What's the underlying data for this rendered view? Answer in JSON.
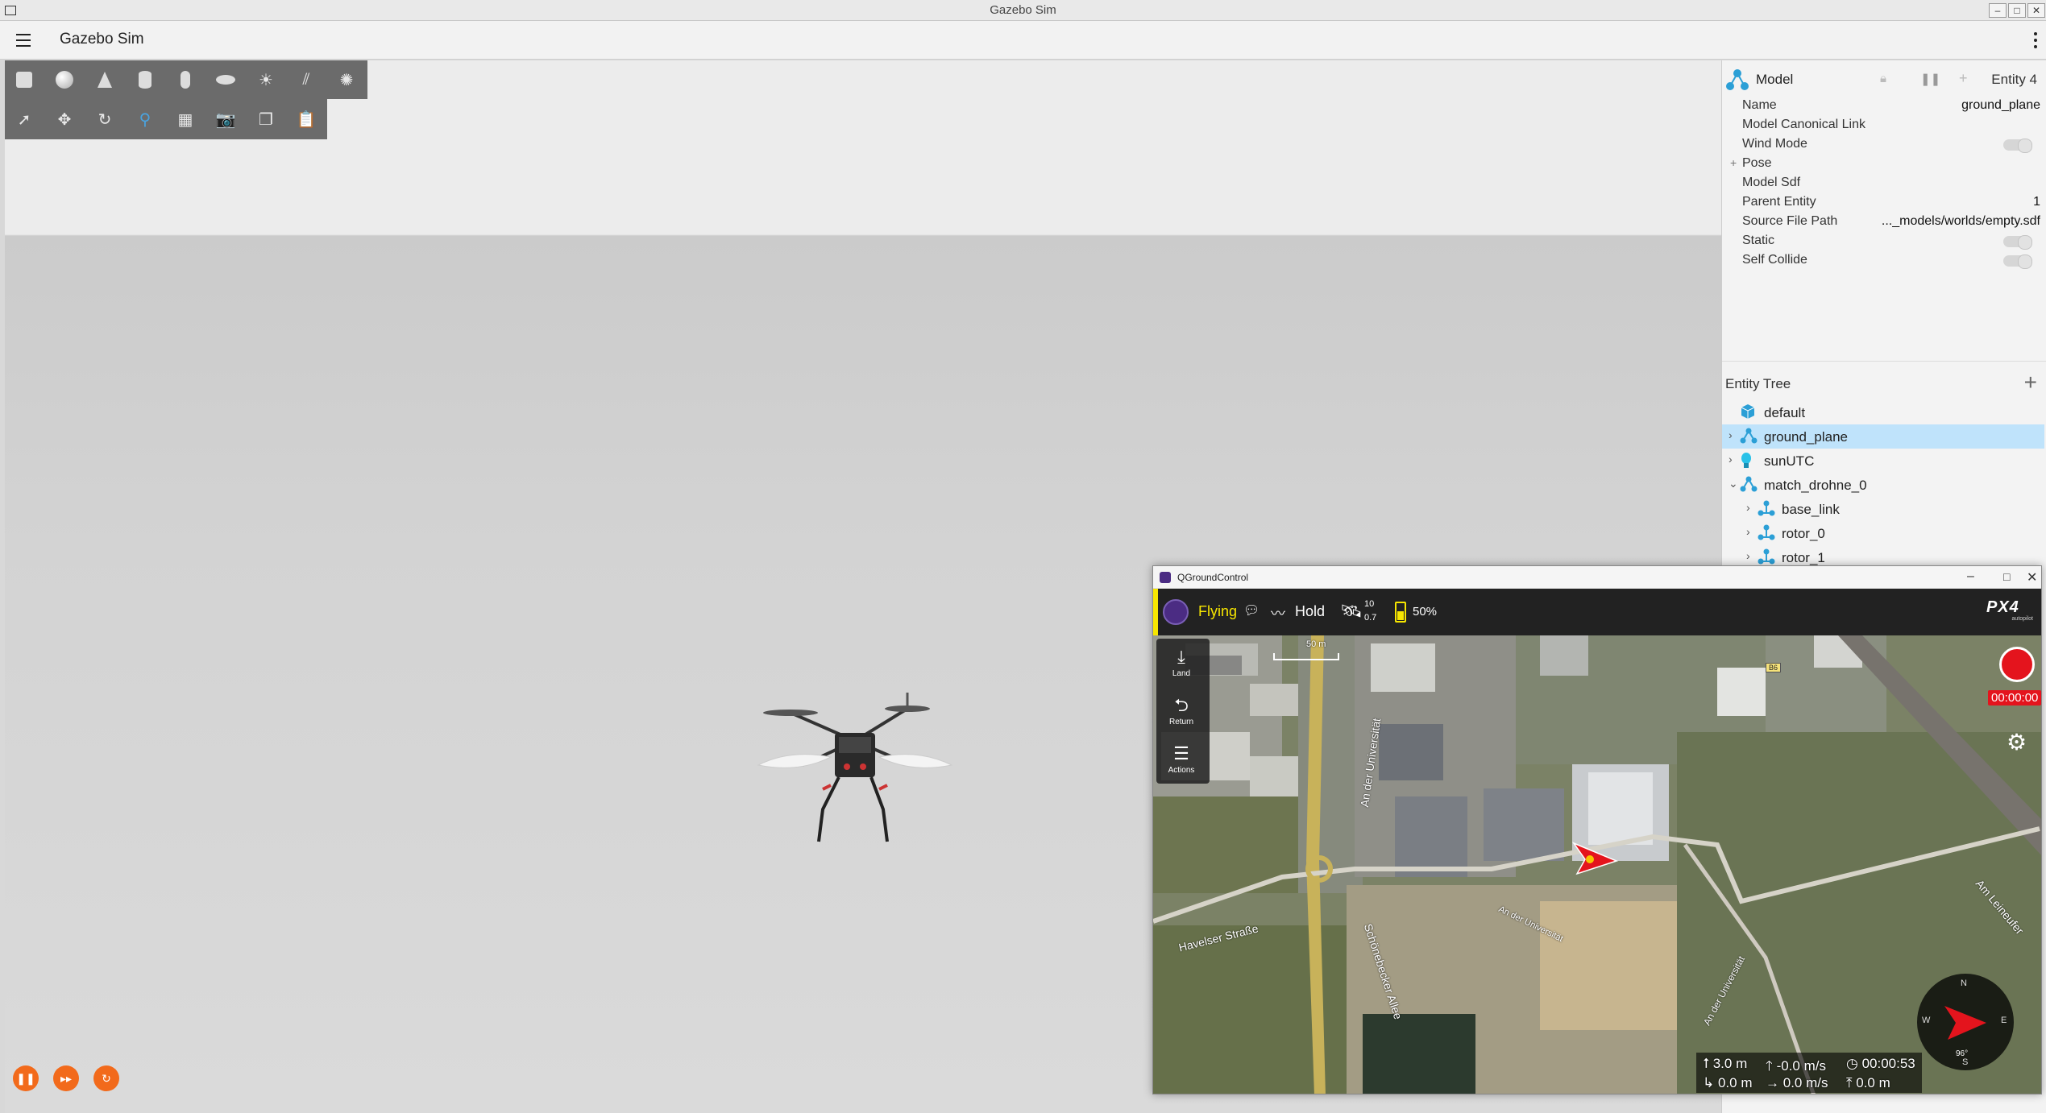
{
  "os_window": {
    "title": "Gazebo Sim",
    "buttons": [
      "–",
      "□",
      "✕"
    ]
  },
  "gazebo": {
    "app_title": "Gazebo Sim",
    "shape_toolbar": [
      "box-icon",
      "sphere-icon",
      "cone-icon",
      "cylinder-icon",
      "capsule-icon",
      "ellipsoid-icon",
      "point-light-icon",
      "directional-light-icon",
      "spot-light-icon"
    ],
    "transform_toolbar": [
      "select-icon",
      "translate-icon",
      "rotate-icon",
      "snap-icon",
      "grid-icon",
      "screenshot-icon",
      "copy-icon",
      "paste-icon"
    ],
    "playback": [
      "pause-icon",
      "step-icon",
      "reset-icon"
    ]
  },
  "component_inspector": {
    "header_type": "Model",
    "header_entity": "Entity 4",
    "rows": [
      {
        "key": "Name",
        "value": "ground_plane",
        "kind": "text"
      },
      {
        "key": "Model Canonical Link",
        "value": "",
        "kind": "text"
      },
      {
        "key": "Wind Mode",
        "value": "",
        "kind": "toggle"
      },
      {
        "key": "Pose",
        "value": "",
        "kind": "expand",
        "prefix": "+"
      },
      {
        "key": "Model Sdf",
        "value": "",
        "kind": "text"
      },
      {
        "key": "Parent Entity",
        "value": "1",
        "kind": "text"
      },
      {
        "key": "Source File Path",
        "value": "..._models/worlds/empty.sdf",
        "kind": "text"
      },
      {
        "key": "Static",
        "value": "",
        "kind": "toggle"
      },
      {
        "key": "Self Collide",
        "value": "",
        "kind": "toggle"
      }
    ]
  },
  "entity_tree": {
    "title": "Entity Tree",
    "add_label": "+",
    "items": [
      {
        "label": "default",
        "icon": "world-cube-icon",
        "arrow": "",
        "indent": 0,
        "selected": false
      },
      {
        "label": "ground_plane",
        "icon": "model-icon",
        "arrow": "›",
        "indent": 0,
        "selected": true
      },
      {
        "label": "sunUTC",
        "icon": "light-bulb-icon",
        "arrow": "›",
        "indent": 0,
        "selected": false
      },
      {
        "label": "match_drohne_0",
        "icon": "model-icon",
        "arrow": "⌄",
        "indent": 0,
        "selected": false
      },
      {
        "label": "base_link",
        "icon": "link-icon",
        "arrow": "›",
        "indent": 1,
        "selected": false
      },
      {
        "label": "rotor_0",
        "icon": "link-icon",
        "arrow": "›",
        "indent": 1,
        "selected": false
      },
      {
        "label": "rotor_1",
        "icon": "link-icon",
        "arrow": "›",
        "indent": 1,
        "selected": false
      }
    ]
  },
  "qgc": {
    "window_title": "QGroundControl",
    "flight_status": "Flying",
    "flight_mode": "Hold",
    "satellites": "10",
    "hdop": "0.7",
    "battery": "50%",
    "brand": "PX4",
    "brand_sub": "autopilot",
    "left_tools": [
      {
        "label": "Land",
        "icon": "land-icon"
      },
      {
        "label": "Return",
        "icon": "return-icon"
      },
      {
        "label": "Actions",
        "icon": "menu-icon"
      }
    ],
    "scale": "50 m",
    "record_time": "00:00:00",
    "road_label": "B6",
    "streets": [
      "An der Universität",
      "Schönebecker Allee",
      "Havelser Straße",
      "An der Universität",
      "An der Universität",
      "Am Leineufer"
    ],
    "compass": {
      "n": "N",
      "e": "E",
      "s": "S",
      "w": "W",
      "heading": "96°"
    },
    "telemetry": {
      "altitude": "3.0 m",
      "vertical_speed": "-0.0 m/s",
      "flight_time": "00:00:53",
      "distance": "0.0 m",
      "ground_speed": "0.0 m/s",
      "distance_home": "0.0 m"
    }
  },
  "colors": {
    "accent_qgc": "#f7e600",
    "record_red": "#e4141d",
    "selection_blue": "#bfe3fb",
    "play_orange": "#f26a1b",
    "gazebo_icon_blue": "#2b9fd6"
  }
}
